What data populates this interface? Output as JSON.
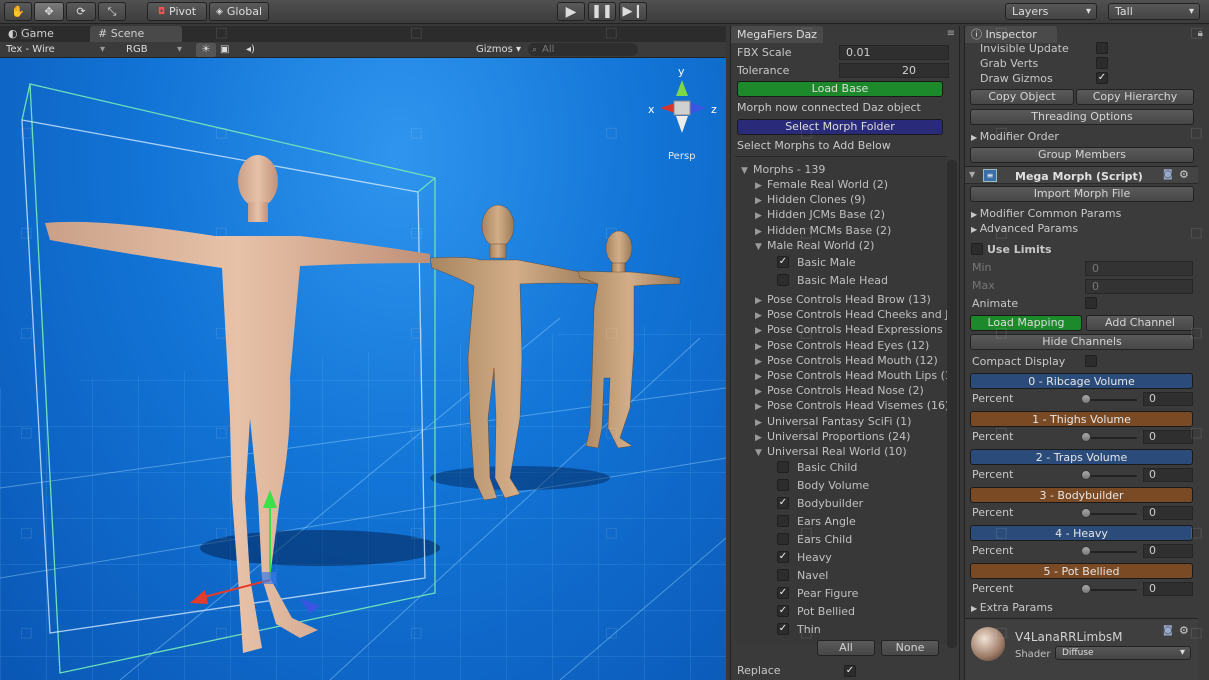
{
  "toolbar": {
    "pivot_label": "Pivot",
    "global_label": "Global",
    "layers_label": "Layers",
    "layout_label": "Tall"
  },
  "scene": {
    "tab_game": "Game",
    "tab_scene": "Scene",
    "render_mode": "Tex - Wire",
    "color_mode": "RGB",
    "gizmos_label": "Gizmos",
    "search_placeholder": "All",
    "persp_label": "Persp",
    "axis_x": "x",
    "axis_y": "y",
    "axis_z": "z"
  },
  "megafiers": {
    "title": "MegaFiers Daz",
    "fbx_scale_label": "FBX Scale",
    "fbx_scale_value": "0.01",
    "tolerance_label": "Tolerance",
    "tolerance_value": "20",
    "load_base_label": "Load Base",
    "status_text": "Morph now connected Daz object",
    "select_folder_label": "Select Morph Folder",
    "select_morphs_text": "Select Morphs to Add Below",
    "morphs_header": "Morphs - 139",
    "groups": [
      {
        "label": "Female Real World (2)",
        "open": false
      },
      {
        "label": "Hidden Clones (9)",
        "open": false
      },
      {
        "label": "Hidden JCMs Base (2)",
        "open": false
      },
      {
        "label": "Hidden MCMs Base (2)",
        "open": false
      },
      {
        "label": "Male Real World (2)",
        "open": true
      }
    ],
    "male_items": [
      {
        "label": "Basic Male",
        "checked": true
      },
      {
        "label": "Basic Male Head",
        "checked": false
      }
    ],
    "groups2": [
      {
        "label": "Pose Controls Head Brow (13)",
        "open": false
      },
      {
        "label": "Pose Controls Head Cheeks and J",
        "open": false
      },
      {
        "label": "Pose Controls Head Expressions (",
        "open": false
      },
      {
        "label": "Pose Controls Head Eyes (12)",
        "open": false
      },
      {
        "label": "Pose Controls Head Mouth (12)",
        "open": false
      },
      {
        "label": "Pose Controls Head Mouth Lips (1",
        "open": false
      },
      {
        "label": "Pose Controls Head Nose (2)",
        "open": false
      },
      {
        "label": "Pose Controls Head Visemes (16)",
        "open": false
      },
      {
        "label": "Universal Fantasy SciFi (1)",
        "open": false
      },
      {
        "label": "Universal Proportions (24)",
        "open": false
      },
      {
        "label": "Universal Real World (10)",
        "open": true
      }
    ],
    "universal_items": [
      {
        "label": "Basic Child",
        "checked": false
      },
      {
        "label": "Body Volume",
        "checked": false
      },
      {
        "label": "Bodybuilder",
        "checked": true
      },
      {
        "label": "Ears Angle",
        "checked": false
      },
      {
        "label": "Ears Child",
        "checked": false
      },
      {
        "label": "Heavy",
        "checked": true
      },
      {
        "label": "Navel",
        "checked": false
      },
      {
        "label": "Pear Figure",
        "checked": true
      },
      {
        "label": "Pot Bellied",
        "checked": true
      },
      {
        "label": "Thin",
        "checked": true
      }
    ],
    "all_label": "All",
    "none_label": "None",
    "replace_label": "Replace"
  },
  "inspector": {
    "title": "Inspector",
    "invisible_update": "Invisible Update",
    "grab_verts": "Grab Verts",
    "draw_gizmos": "Draw Gizmos",
    "copy_object": "Copy Object",
    "copy_hierarchy": "Copy Hierarchy",
    "threading_options": "Threading Options",
    "modifier_order": "Modifier Order",
    "group_members": "Group Members",
    "component_title": "Mega Morph (Script)",
    "import_morph_file": "Import Morph File",
    "modifier_common_params": "Modifier Common Params",
    "advanced_params": "Advanced Params",
    "use_limits": "Use Limits",
    "min_label": "Min",
    "min_value": "0",
    "max_label": "Max",
    "max_value": "0",
    "animate_label": "Animate",
    "load_mapping": "Load Mapping",
    "add_channel": "Add Channel",
    "hide_channels": "Hide Channels",
    "compact_display": "Compact Display",
    "percent_label": "Percent",
    "channels": [
      {
        "label": "0 - Ribcage Volume",
        "color": "#2b4c7a",
        "percent": "0"
      },
      {
        "label": "1 - Thighs Volume",
        "color": "#7a4a25",
        "percent": "0"
      },
      {
        "label": "2 - Traps Volume",
        "color": "#2b4c7a",
        "percent": "0"
      },
      {
        "label": "3 - Bodybuilder",
        "color": "#7a4a25",
        "percent": "0"
      },
      {
        "label": "4 - Heavy",
        "color": "#2b4c7a",
        "percent": "0"
      },
      {
        "label": "5 - Pot Bellied",
        "color": "#7a4a25",
        "percent": "0"
      }
    ],
    "extra_params": "Extra Params",
    "material_name": "V4LanaRRLimbsM",
    "shader_label": "Shader",
    "shader_value": "Diffuse"
  },
  "colors": {
    "load_green": "#1c8a2a",
    "select_blue": "#2a2a7a",
    "viewport_blue": "#1274d6"
  }
}
